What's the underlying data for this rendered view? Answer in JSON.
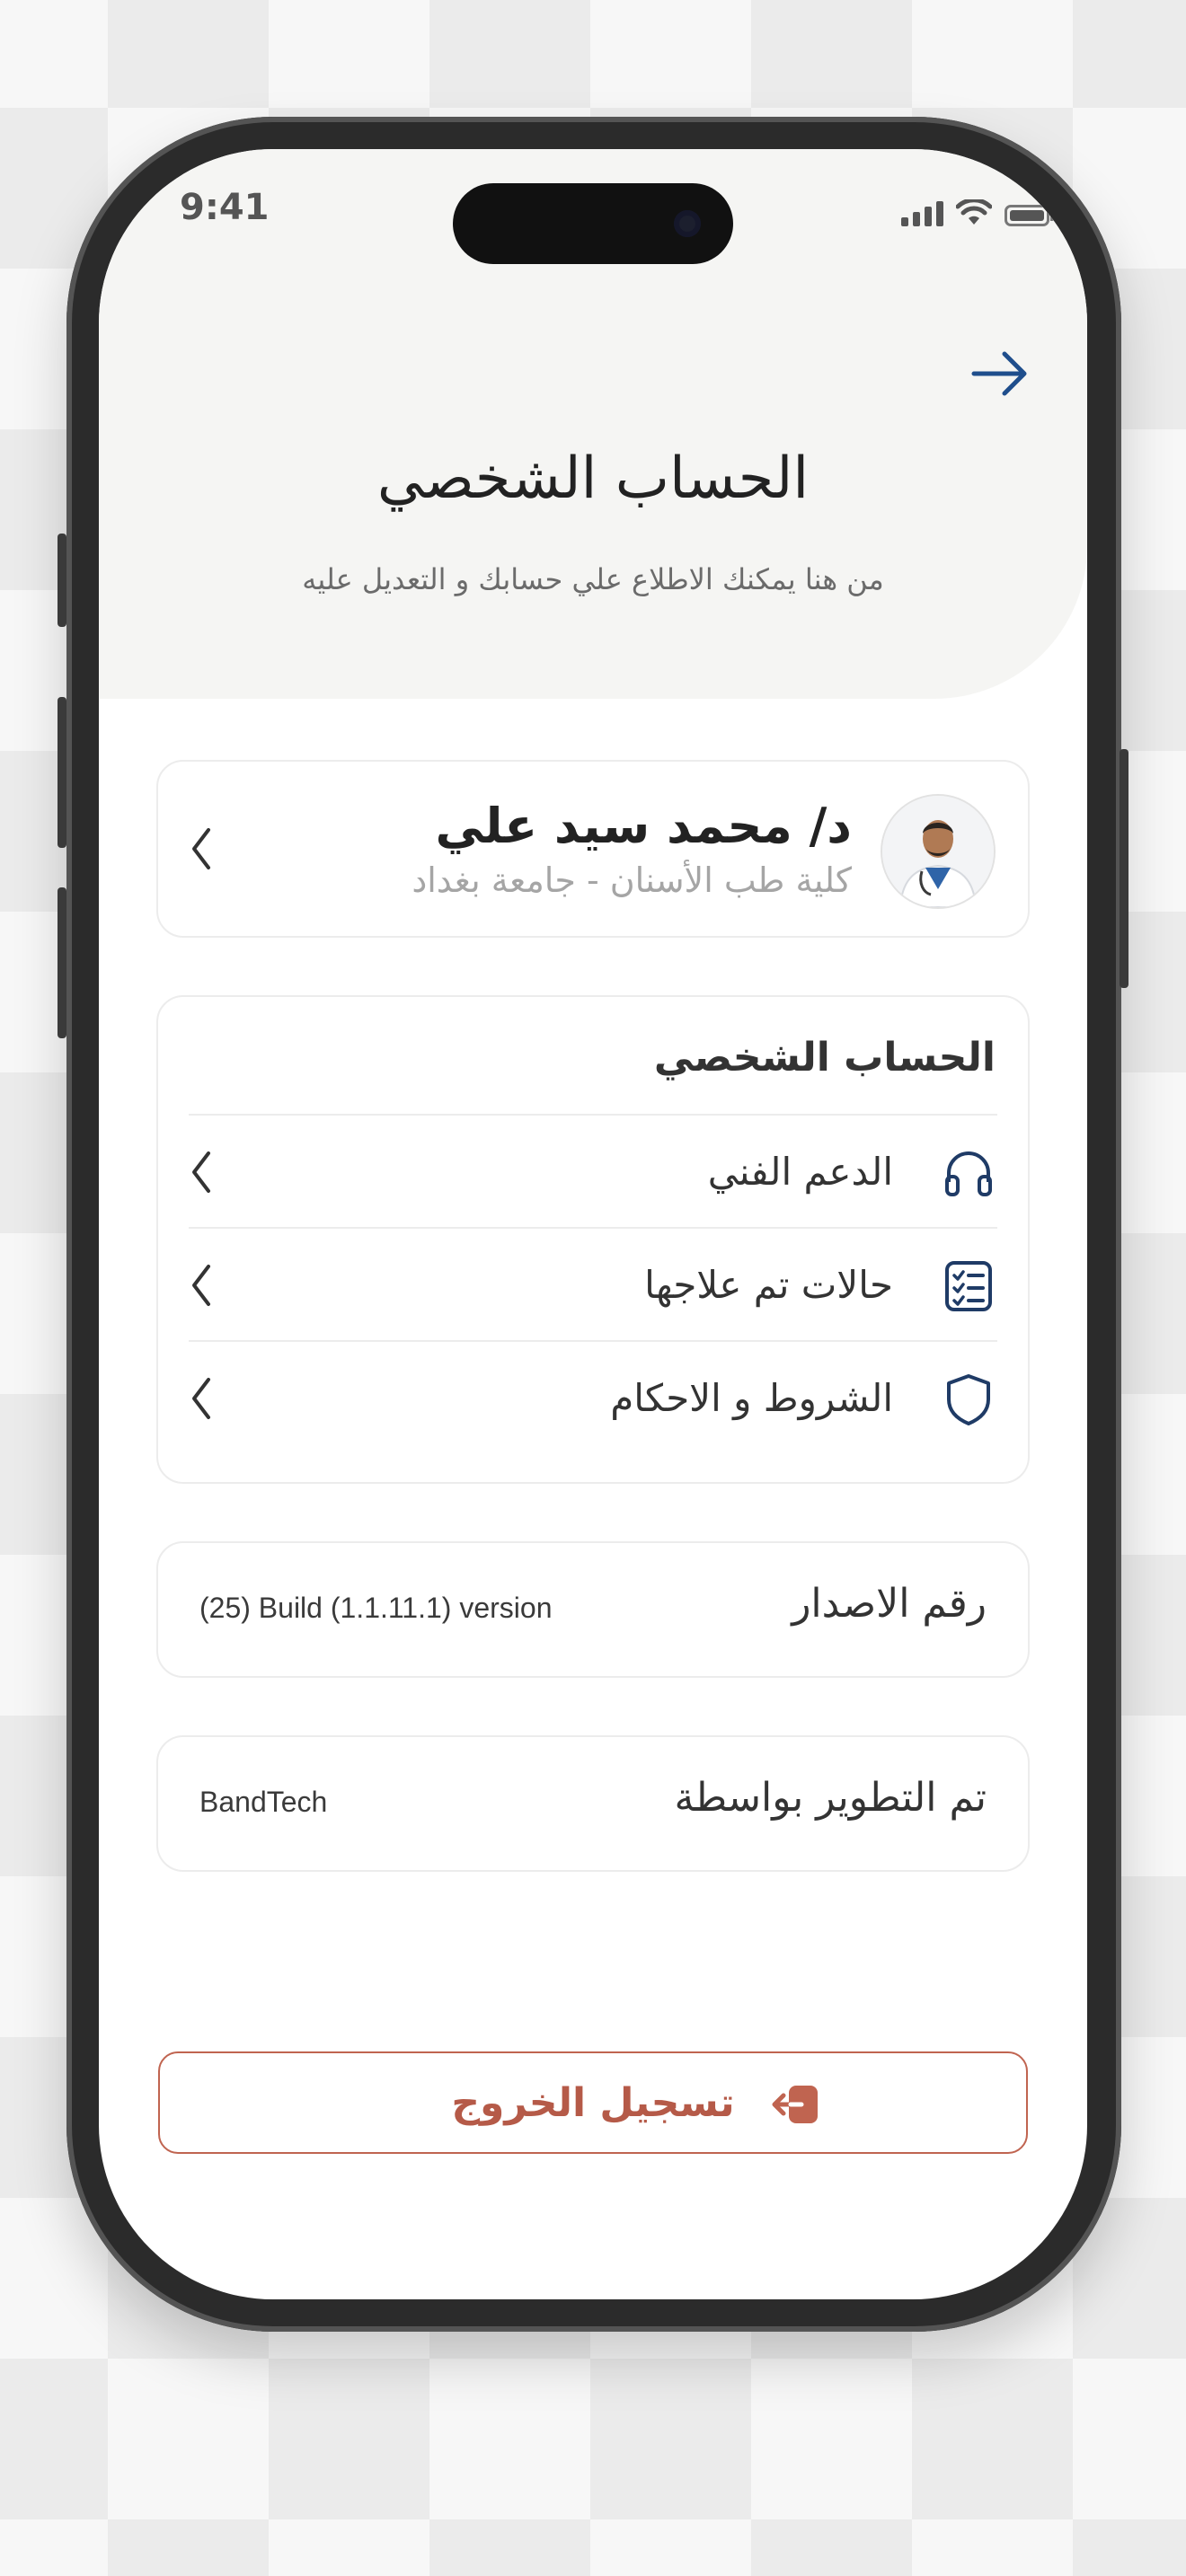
{
  "status_bar": {
    "time": "9:41"
  },
  "header": {
    "title": "الحساب الشخصي",
    "subtitle": "من هنا يمكنك الاطلاع علي حسابك و التعديل عليه"
  },
  "profile": {
    "name": "د/ محمد سيد علي",
    "affiliation": "كلية طب الأسنان - جامعة بغداد"
  },
  "account_menu": {
    "title": "الحساب الشخصي",
    "items": [
      {
        "label": "الدعم الفني",
        "icon": "headphones-icon"
      },
      {
        "label": "حالات تم علاجها",
        "icon": "checklist-icon"
      },
      {
        "label": "الشروط و الاحكام",
        "icon": "shield-icon"
      }
    ]
  },
  "version_info": {
    "label": "رقم الاصدار",
    "value": "(25) Build (1.1.11.1) version"
  },
  "developer_info": {
    "label": "تم التطوير بواسطة",
    "value": "BandTech"
  },
  "logout": {
    "label": "تسجيل الخروج",
    "icon": "logout-icon"
  },
  "colors": {
    "accent_blue": "#1f4e8c",
    "logout_red": "#c06450",
    "header_bg": "#f5f5f3"
  }
}
